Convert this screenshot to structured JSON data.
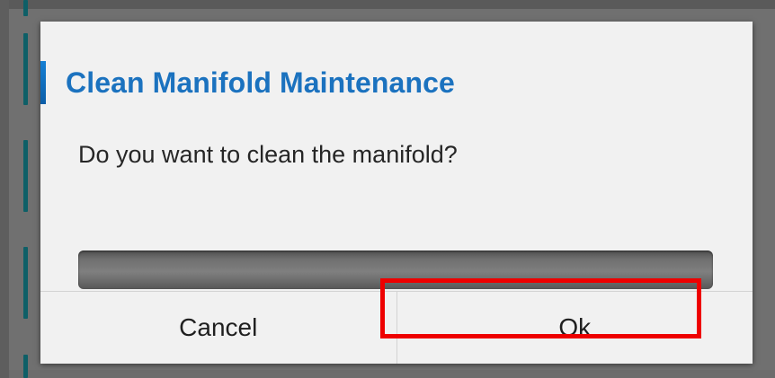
{
  "dialog": {
    "title": "Clean Manifold Maintenance",
    "message": "Do you want to clean the manifold?",
    "progress": 0
  },
  "buttons": {
    "cancel_label": "Cancel",
    "ok_label": "Ok"
  },
  "colors": {
    "title": "#1b72bf",
    "accent": "#1680d4",
    "highlight": "#ee0000",
    "teal_marker": "#0e5f67"
  }
}
